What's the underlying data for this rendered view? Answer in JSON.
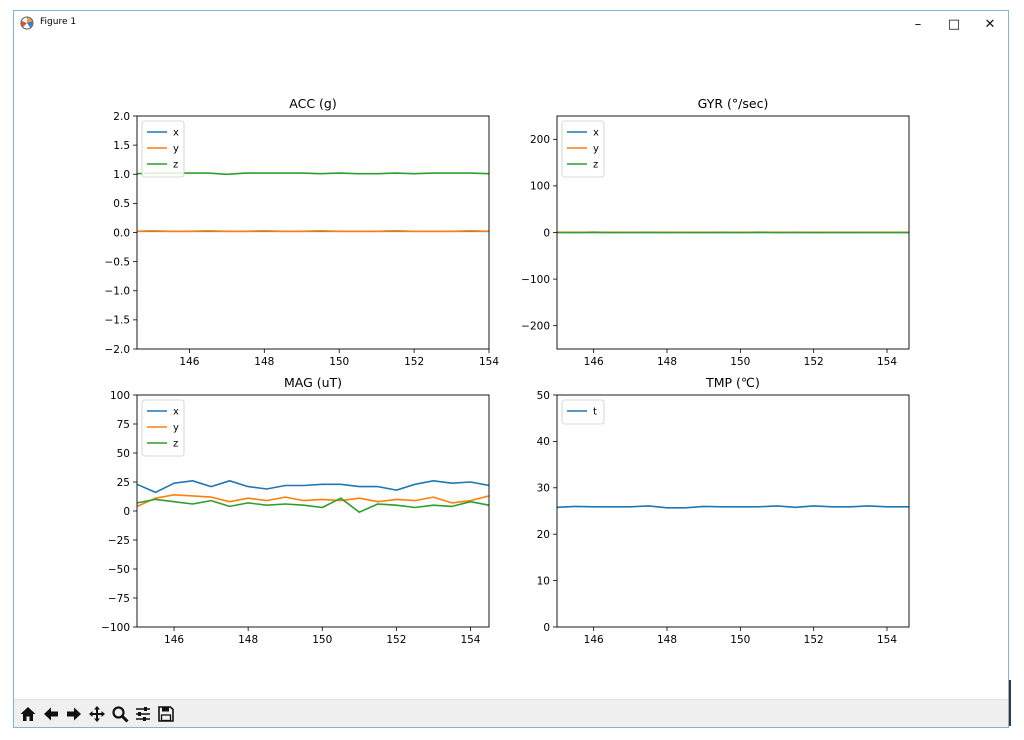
{
  "window": {
    "title": "Figure 1",
    "controls": {
      "minimize": "–",
      "maximize": "□",
      "close": "✕"
    }
  },
  "toolbar": {
    "buttons": [
      "home-icon",
      "back-icon",
      "forward-icon",
      "pan-icon",
      "zoom-icon",
      "configure-subplots-icon",
      "save-icon"
    ]
  },
  "colors": {
    "x": "#1f77b4",
    "y": "#ff7f0e",
    "z": "#2ca02c",
    "t": "#1f77b4"
  },
  "chart_data": [
    {
      "type": "line",
      "title": "ACC (g)",
      "xlim": [
        144.6,
        154
      ],
      "ylim": [
        -2.0,
        2.0
      ],
      "xticks": [
        146,
        148,
        150,
        152,
        154
      ],
      "yticks": [
        "2.0",
        "1.5",
        "1.0",
        "0.5",
        "0.0",
        "−0.5",
        "−1.0",
        "−1.5",
        "−2.0"
      ],
      "ytick_values": [
        2.0,
        1.5,
        1.0,
        0.5,
        0.0,
        -0.5,
        -1.0,
        -1.5,
        -2.0
      ],
      "legend": "top-left",
      "x": [
        144.6,
        145.0,
        145.5,
        146.0,
        146.5,
        147.0,
        147.5,
        148.0,
        148.5,
        149.0,
        149.5,
        150.0,
        150.5,
        151.0,
        151.5,
        152.0,
        152.5,
        153.0,
        153.5,
        154.0
      ],
      "series": [
        {
          "name": "x",
          "values": [
            0.02,
            0.02,
            0.02,
            0.02,
            0.02,
            0.02,
            0.02,
            0.02,
            0.02,
            0.02,
            0.02,
            0.02,
            0.02,
            0.02,
            0.02,
            0.02,
            0.02,
            0.02,
            0.02,
            0.02
          ]
        },
        {
          "name": "y",
          "values": [
            0.02,
            0.03,
            0.02,
            0.02,
            0.03,
            0.02,
            0.02,
            0.03,
            0.02,
            0.02,
            0.03,
            0.02,
            0.02,
            0.02,
            0.03,
            0.02,
            0.02,
            0.02,
            0.03,
            0.02
          ]
        },
        {
          "name": "z",
          "values": [
            1.01,
            1.02,
            1.02,
            1.02,
            1.02,
            1.0,
            1.02,
            1.02,
            1.02,
            1.02,
            1.01,
            1.02,
            1.01,
            1.01,
            1.02,
            1.01,
            1.02,
            1.02,
            1.02,
            1.01
          ]
        }
      ]
    },
    {
      "type": "line",
      "title": "GYR (°/sec)",
      "xlim": [
        145,
        154.6
      ],
      "ylim": [
        -250,
        250
      ],
      "xticks": [
        146,
        148,
        150,
        152,
        154
      ],
      "yticks": [
        "200",
        "100",
        "0",
        "−100",
        "−200"
      ],
      "ytick_values": [
        200,
        100,
        0,
        -100,
        -200
      ],
      "legend": "top-left",
      "x": [
        145.0,
        145.5,
        146.0,
        146.5,
        147.0,
        147.5,
        148.0,
        148.5,
        149.0,
        149.5,
        150.0,
        150.5,
        151.0,
        151.5,
        152.0,
        152.5,
        153.0,
        153.5,
        154.0,
        154.6
      ],
      "series": [
        {
          "name": "x",
          "values": [
            0.5,
            0.3,
            0.6,
            0.2,
            0.4,
            0.5,
            0.3,
            0.4,
            0.2,
            0.5,
            0.3,
            0.6,
            0.2,
            0.4,
            0.3,
            0.5,
            0.2,
            0.4,
            0.5,
            0.3
          ]
        },
        {
          "name": "y",
          "values": [
            0.2,
            0.4,
            0.1,
            0.3,
            0.2,
            0.1,
            0.4,
            0.2,
            0.3,
            0.1,
            0.2,
            0.3,
            0.4,
            0.1,
            0.2,
            0.3,
            0.1,
            0.2,
            0.3,
            0.2
          ]
        },
        {
          "name": "z",
          "values": [
            0.0,
            0.1,
            -0.1,
            0.0,
            0.1,
            0.0,
            -0.1,
            0.0,
            0.1,
            0.0,
            0.0,
            -0.1,
            0.1,
            0.0,
            0.0,
            0.1,
            0.0,
            -0.1,
            0.0,
            0.1
          ]
        }
      ]
    },
    {
      "type": "line",
      "title": "MAG (uT)",
      "xlim": [
        145,
        154.5
      ],
      "ylim": [
        -100,
        100
      ],
      "xticks": [
        146,
        148,
        150,
        152,
        154
      ],
      "yticks": [
        "100",
        "75",
        "50",
        "25",
        "0",
        "−25",
        "−50",
        "−75",
        "−100"
      ],
      "ytick_values": [
        100,
        75,
        50,
        25,
        0,
        -25,
        -50,
        -75,
        -100
      ],
      "legend": "top-left",
      "x": [
        145.0,
        145.5,
        146.0,
        146.5,
        147.0,
        147.5,
        148.0,
        148.5,
        149.0,
        149.5,
        150.0,
        150.5,
        151.0,
        151.5,
        152.0,
        152.5,
        153.0,
        153.5,
        154.0,
        154.5
      ],
      "series": [
        {
          "name": "x",
          "values": [
            23,
            16,
            24,
            26,
            21,
            26,
            21,
            19,
            22,
            22,
            23,
            23,
            21,
            21,
            18,
            23,
            26,
            24,
            25,
            22
          ]
        },
        {
          "name": "y",
          "values": [
            4,
            11,
            14,
            13,
            12,
            8,
            11,
            9,
            12,
            9,
            10,
            9,
            11,
            8,
            10,
            9,
            12,
            7,
            9,
            13
          ]
        },
        {
          "name": "z",
          "values": [
            7,
            10,
            8,
            6,
            9,
            4,
            7,
            5,
            6,
            5,
            3,
            11,
            -1,
            6,
            5,
            3,
            5,
            4,
            8,
            5
          ]
        }
      ]
    },
    {
      "type": "line",
      "title": "TMP (℃)",
      "xlim": [
        145,
        154.6
      ],
      "ylim": [
        0,
        50
      ],
      "xticks": [
        146,
        148,
        150,
        152,
        154
      ],
      "yticks": [
        "50",
        "40",
        "30",
        "20",
        "10",
        "0"
      ],
      "ytick_values": [
        50,
        40,
        30,
        20,
        10,
        0
      ],
      "legend": "top-left",
      "x": [
        145.0,
        145.5,
        146.0,
        146.5,
        147.0,
        147.5,
        148.0,
        148.5,
        149.0,
        149.5,
        150.0,
        150.5,
        151.0,
        151.5,
        152.0,
        152.5,
        153.0,
        153.5,
        154.0,
        154.6
      ],
      "series": [
        {
          "name": "t",
          "values": [
            25.8,
            26.0,
            25.9,
            25.9,
            25.9,
            26.1,
            25.7,
            25.7,
            26.0,
            25.9,
            25.9,
            25.9,
            26.1,
            25.8,
            26.1,
            25.9,
            25.9,
            26.1,
            25.9,
            25.9
          ]
        }
      ]
    }
  ]
}
